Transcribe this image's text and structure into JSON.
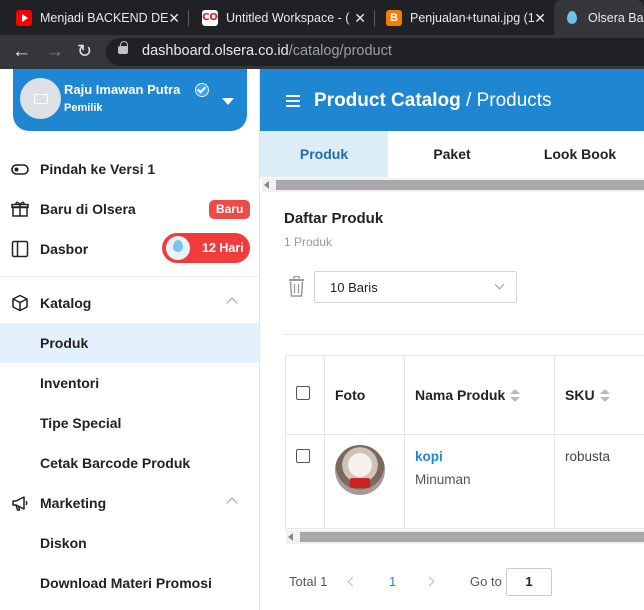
{
  "browser": {
    "tabs": [
      {
        "title": "Menjadi BACKEND DE",
        "favicon": "youtube-icon",
        "color": "#ff0000"
      },
      {
        "title": "Untitled Workspace - (",
        "favicon": "codepen-icon",
        "color": "#ffffff"
      },
      {
        "title": "Penjualan+tunai.jpg (1",
        "favicon": "blogger-icon",
        "color": "#f57c00"
      },
      {
        "title": "Olsera Bac",
        "favicon": "olsera-icon",
        "color": "#6ec1ea"
      }
    ],
    "url_host": "dashboard.olsera.co.id",
    "url_path": "/catalog/product"
  },
  "user": {
    "name": "Raju Imawan Putra",
    "role": "Pemilik"
  },
  "sidebar": {
    "items": [
      {
        "label": "Pindah ke Versi 1",
        "icon": "toggle-icon"
      },
      {
        "label": "Baru di Olsera",
        "icon": "gift-icon",
        "badge": "Baru"
      },
      {
        "label": "Dasbor",
        "icon": "sidebar-layout-icon",
        "badge": "12 Hari"
      },
      {
        "label": "Katalog",
        "icon": "box-icon"
      },
      {
        "label": "Produk"
      },
      {
        "label": "Inventori"
      },
      {
        "label": "Tipe Special"
      },
      {
        "label": "Cetak Barcode Produk"
      },
      {
        "label": "Marketing",
        "icon": "megaphone-icon"
      },
      {
        "label": "Diskon"
      },
      {
        "label": "Download Materi Promosi"
      }
    ]
  },
  "header": {
    "title": "Product Catalog",
    "separator": "/",
    "subtitle": "Products"
  },
  "tabs": [
    "Produk",
    "Paket",
    "Look Book"
  ],
  "content": {
    "title": "Daftar Produk",
    "count": "1 Produk",
    "rows_select": "10 Baris"
  },
  "table": {
    "headers": {
      "photo": "Foto",
      "name": "Nama Produk",
      "sku": "SKU"
    },
    "rows": [
      {
        "name": "kopi",
        "category": "Minuman",
        "sku": "robusta"
      }
    ]
  },
  "pagination": {
    "total_label": "Total 1",
    "current_page": "1",
    "goto_label": "Go to",
    "goto_value": "1"
  },
  "colors": {
    "primary": "#1f86d1",
    "badge_red": "#ee4a4a",
    "active_bg": "#e2f1fb"
  }
}
